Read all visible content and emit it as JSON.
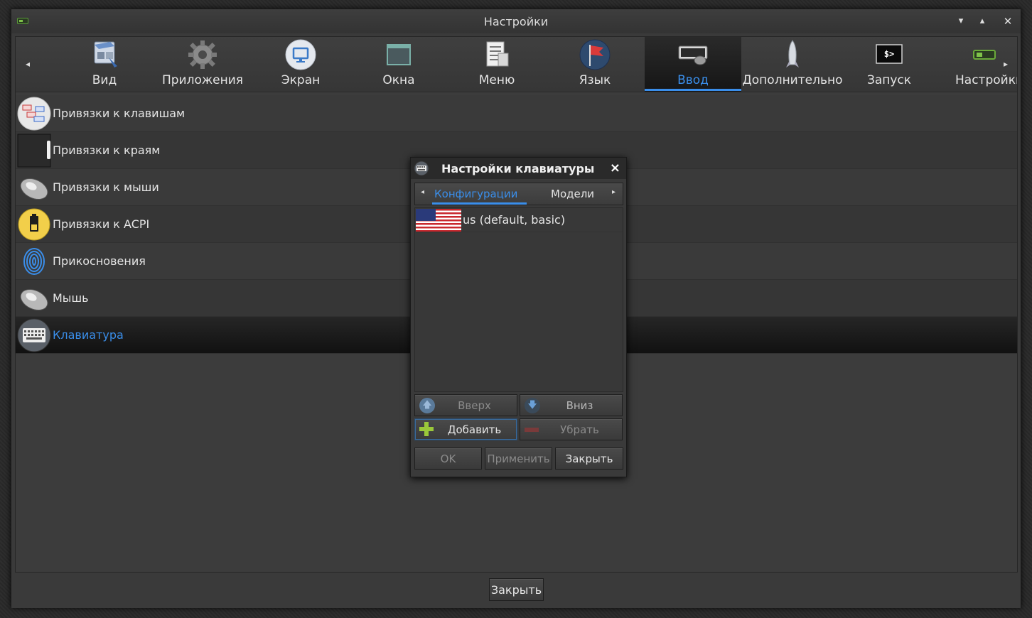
{
  "window": {
    "title": "Настройки"
  },
  "toolbar": {
    "items": [
      {
        "label": "Вид",
        "icon": "look-icon"
      },
      {
        "label": "Приложения",
        "icon": "gear-icon"
      },
      {
        "label": "Экран",
        "icon": "monitor-icon"
      },
      {
        "label": "Окна",
        "icon": "window-icon"
      },
      {
        "label": "Меню",
        "icon": "menu-icon"
      },
      {
        "label": "Язык",
        "icon": "flag-icon"
      },
      {
        "label": "Ввод",
        "icon": "keyboard-mouse-icon"
      },
      {
        "label": "Дополнительно",
        "icon": "rocket-icon"
      },
      {
        "label": "Запуск",
        "icon": "terminal-icon"
      },
      {
        "label": "Настройки",
        "icon": "settings-icon"
      }
    ],
    "active_index": 6,
    "terminal_glyph": "$>"
  },
  "list": {
    "items": [
      {
        "label": "Привязки к клавишам",
        "icon": "keybindings-icon"
      },
      {
        "label": "Привязки к краям",
        "icon": "edge-bindings-icon"
      },
      {
        "label": "Привязки к мыши",
        "icon": "mouse-icon"
      },
      {
        "label": "Привязки к ACPI",
        "icon": "battery-icon"
      },
      {
        "label": "Прикосновения",
        "icon": "fingerprint-icon"
      },
      {
        "label": "Мышь",
        "icon": "mouse-icon"
      },
      {
        "label": "Клавиатура",
        "icon": "keyboard-icon"
      }
    ],
    "selected_index": 6
  },
  "bottom": {
    "close_label": "Закрыть"
  },
  "dialog": {
    "title": "Настройки клавиатуры",
    "close_glyph": "×",
    "tabs": [
      "Конфигурации",
      "Модели"
    ],
    "active_tab": 0,
    "layouts": [
      {
        "label": "us (default, basic)",
        "icon": "us-flag-icon"
      }
    ],
    "buttons": {
      "up": "Вверх",
      "down": "Вниз",
      "add": "Добавить",
      "remove": "Убрать",
      "ok": "OK",
      "apply": "Применить",
      "close": "Закрыть"
    }
  },
  "colors": {
    "accent": "#3a8eea",
    "background": "#3a3a3a",
    "selected_row": "#151515"
  }
}
